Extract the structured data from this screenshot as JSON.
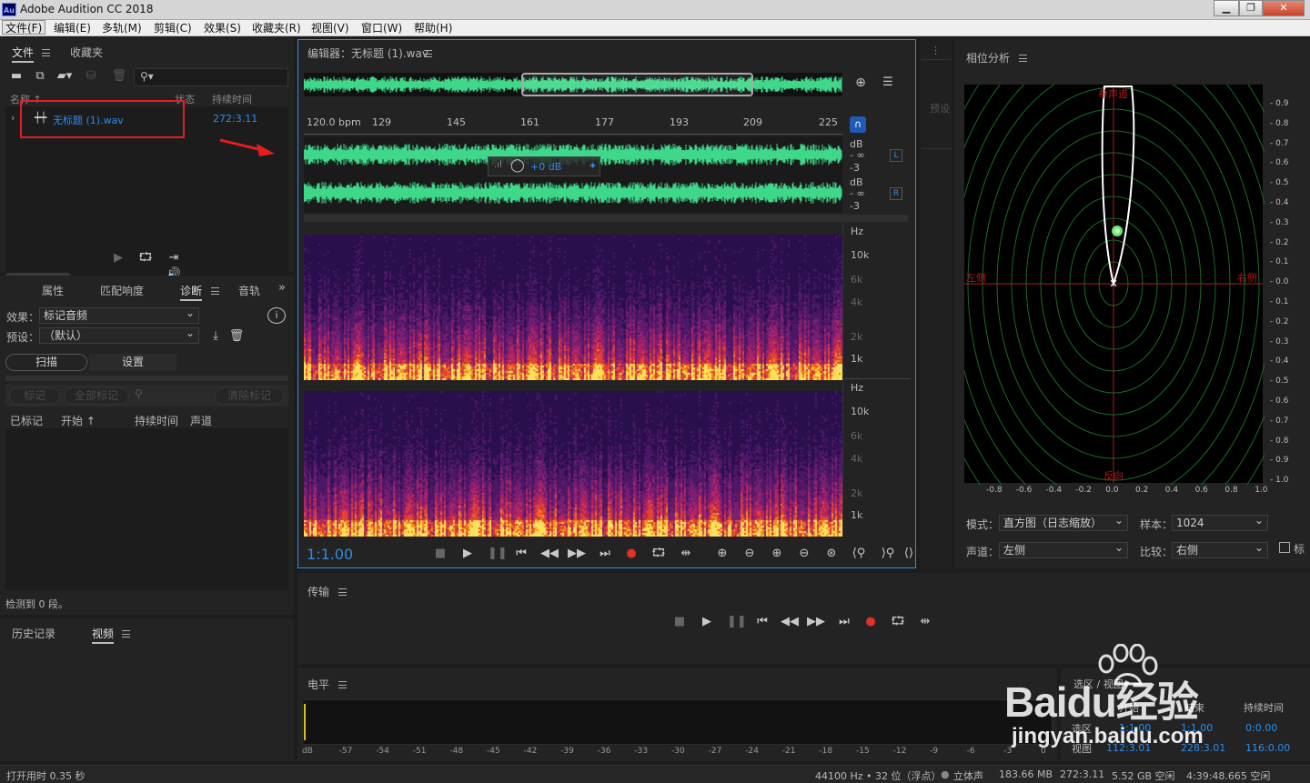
{
  "app": {
    "title": "Adobe Audition CC 2018",
    "logo": "Au"
  },
  "menu": [
    "文件(F)",
    "编辑(E)",
    "多轨(M)",
    "剪辑(C)",
    "效果(S)",
    "收藏夹(R)",
    "视图(V)",
    "窗口(W)",
    "帮助(H)"
  ],
  "files_panel": {
    "tabs": [
      "文件",
      "收藏夹"
    ],
    "columns": {
      "name": "名称 ↑",
      "status": "状态",
      "duration": "持续时间"
    },
    "file": {
      "name": "无标题 (1).wav",
      "duration": "272:3.11"
    }
  },
  "diag_panel": {
    "tabs": [
      "属性",
      "匹配响度",
      "诊断",
      "音轨"
    ],
    "effect_label": "效果：",
    "effect_value": "标记音频",
    "preset_label": "预设：",
    "preset_value": "（默认）",
    "scan_button": "扫描",
    "settings_button": "设置",
    "mark_button": "标记",
    "mark_all_button": "全部标记",
    "clear_marks_button": "清除标记",
    "columns": [
      "已标记",
      "开始 ↑",
      "持续时间",
      "声道"
    ],
    "status": "检测到 0 段。"
  },
  "history_panel": {
    "tabs": [
      "历史记录",
      "视频"
    ]
  },
  "editor": {
    "title": "编辑器：无标题 (1).wav",
    "bpm": "120.0 bpm",
    "ruler": [
      "129",
      "145",
      "161",
      "177",
      "193",
      "209",
      "225"
    ],
    "hud_gain": "+0 dB",
    "db_scale": [
      "dB",
      "- ∞",
      "-3"
    ],
    "channels": [
      "L",
      "R"
    ],
    "hz_scale": [
      "Hz",
      "10k",
      "6k",
      "4k",
      "2k",
      "1k"
    ],
    "time": "1:1.00"
  },
  "side_strip": {
    "preset_label": "预设"
  },
  "phase_panel": {
    "title": "相位分析",
    "labels": {
      "top": "单声道",
      "left": "左侧",
      "right": "右侧",
      "bottom": "反向"
    },
    "y_scale": [
      "0.9",
      "0.8",
      "0.7",
      "0.6",
      "0.5",
      "0.4",
      "0.3",
      "0.2",
      "0.1",
      "0.0",
      "0.1",
      "0.2",
      "0.3",
      "0.4",
      "0.5",
      "0.6",
      "0.7",
      "0.8",
      "0.9",
      "1.0"
    ],
    "x_scale": [
      "-0.8",
      "-0.6",
      "-0.4",
      "-0.2",
      "0.0",
      "0.2",
      "0.4",
      "0.6",
      "0.8",
      "1.0"
    ],
    "mode_label": "模式：",
    "mode_value": "直方图（日志缩放）",
    "sample_label": "样本：",
    "sample_value": "1024",
    "channel_label": "声道：",
    "channel_value": "左侧",
    "compare_label": "比较：",
    "compare_value": "右侧",
    "check_label": "标"
  },
  "transport_panel": {
    "title": "传输"
  },
  "levels_panel": {
    "title": "电平",
    "scale": [
      "dB",
      "-57",
      "-54",
      "-51",
      "-48",
      "-45",
      "-42",
      "-39",
      "-36",
      "-33",
      "-30",
      "-27",
      "-24",
      "-21",
      "-18",
      "-15",
      "-12",
      "-9",
      "-6",
      "-3",
      "0"
    ]
  },
  "selection_panel": {
    "title": "选区 / 视图",
    "columns": [
      "开始",
      "结束",
      "持续时间"
    ],
    "rows": [
      {
        "label": "选区",
        "start": "1:1.00",
        "end": "1:1.00",
        "duration": "0:0.00"
      },
      {
        "label": "视图",
        "start": "112:3.01",
        "end": "228:3.01",
        "duration": "116:0.00"
      }
    ]
  },
  "status_bar": {
    "left": "打开用时 0.35 秒",
    "items": [
      "44100 Hz • 32 位（浮点）",
      "立体声",
      "183.66 MB",
      "272:3.11",
      "5.52 GB 空闲",
      "4:39:48.665 空闲"
    ]
  },
  "watermark": {
    "brand": "Baidu经验",
    "url": "jingyan.baidu.com"
  },
  "colors": {
    "accent": "#2d8ceb",
    "waveform": "#3fd88a",
    "highlight_box": "#e41e1e",
    "record": "#e0302a"
  }
}
